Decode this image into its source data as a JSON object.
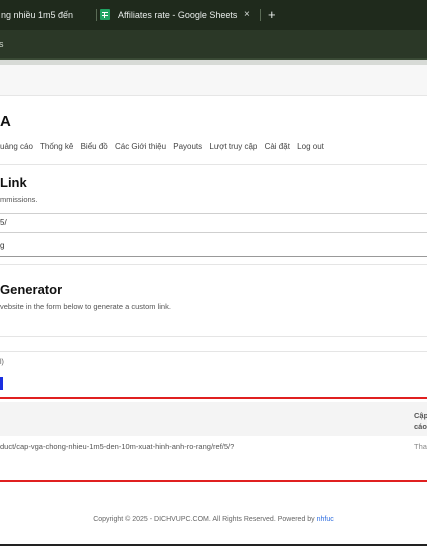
{
  "browser": {
    "tabs": [
      {
        "label": "ng nhiều 1m5 đến"
      },
      {
        "label": "Affiliates rate - Google Sheets"
      }
    ],
    "tab_close_label": "×",
    "new_tab_label": "+",
    "address_text": "s"
  },
  "site": {
    "title": "A",
    "nav": [
      "uảng cáo",
      "Thống kê",
      "Biểu đồ",
      "Các Giới thiệu",
      "Payouts",
      "Lượt truy cập",
      "Cài đặt",
      "Log out"
    ]
  },
  "link_section": {
    "title": "Link",
    "subtitle": "mmissions.",
    "field1_value": "5/",
    "field2_value": "g"
  },
  "generator_section": {
    "title": "Generator",
    "subtitle": "vebsite in the form below to generate a custom link.",
    "small_label": "l)"
  },
  "table": {
    "last_col_header_line1": "Cập",
    "last_col_header_line2": "cáo",
    "row_url": "duct/cap-vga-chong-nhieu-1m5-den-10m-xuat-hinh-anh-ro-rang/ref/5/?",
    "row_last": "Tha"
  },
  "footer": {
    "text": "Copyright © 2025 - DICHVUPC.COM. All Rights Reserved. Powered by",
    "link": "nhfuc"
  }
}
